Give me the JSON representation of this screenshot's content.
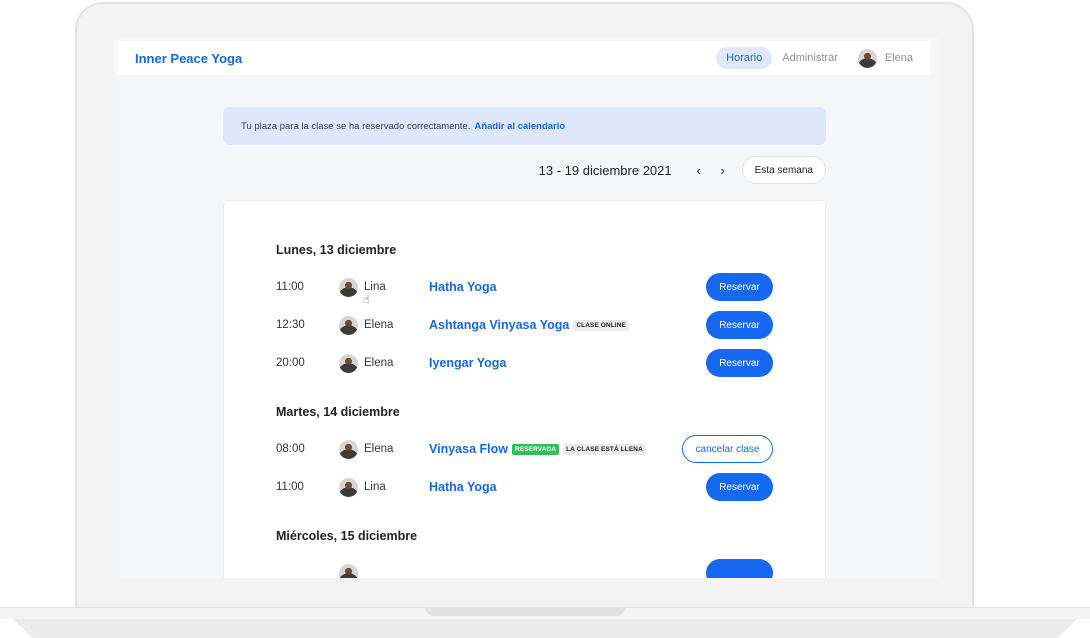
{
  "app": {
    "brand": "Inner Peace Yoga",
    "nav": {
      "schedule": "Horario",
      "manage": "Administrar",
      "user": "Elena"
    }
  },
  "alert": {
    "message": "Tu plaza para la clase se ha reservado correctamente.",
    "link": "Añadir al calendario"
  },
  "week": {
    "range": "13 - 19 diciembre 2021",
    "prev_icon": "‹",
    "next_icon": "›",
    "this_week": "Esta semana"
  },
  "days": [
    {
      "title": "Lunes, 13 diciembre",
      "classes": [
        {
          "time": "11:00",
          "instructor": "Lina",
          "name": "Hatha Yoga",
          "action": "Reservar"
        },
        {
          "time": "12:30",
          "instructor": "Elena",
          "name": "Ashtanga Vinyasa Yoga",
          "tag": "CLASE ONLINE",
          "action": "Reservar"
        },
        {
          "time": "20:00",
          "instructor": "Elena",
          "name": "Iyengar Yoga",
          "action": "Reservar"
        }
      ]
    },
    {
      "title": "Martes, 14 diciembre",
      "classes": [
        {
          "time": "08:00",
          "instructor": "Elena",
          "name": "Vinyasa Flow",
          "tag_reserved": "RESERVADA",
          "tag": "LA CLASE ESTÁ LLENA",
          "action": "cancelar clase"
        },
        {
          "time": "11:00",
          "instructor": "Lina",
          "name": "Hatha Yoga",
          "action": "Reservar"
        }
      ]
    },
    {
      "title": "Miércoles, 15 diciembre"
    }
  ],
  "colors": {
    "accent": "#1668dc",
    "button": "#1668f0",
    "success": "#2fbf5b",
    "alert_bg": "#dfe8fb"
  }
}
